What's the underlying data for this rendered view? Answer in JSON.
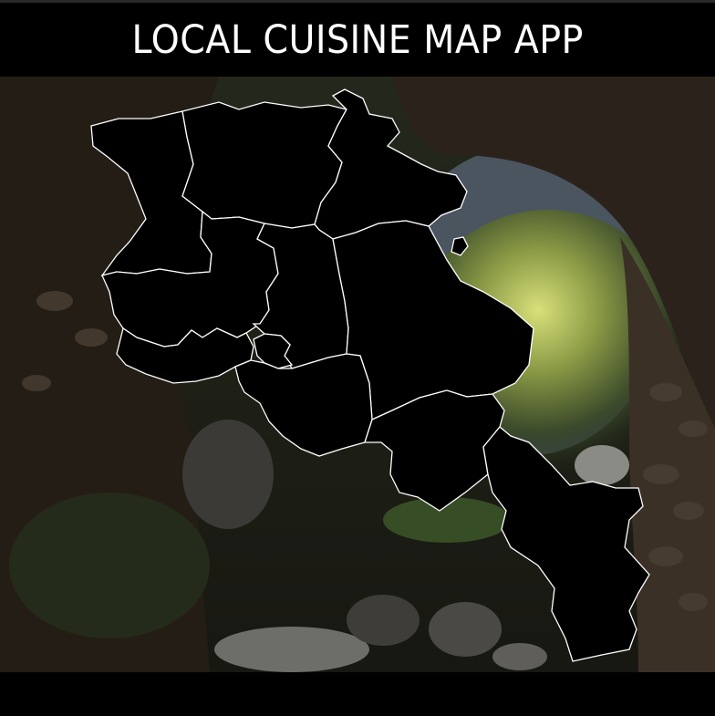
{
  "app": {
    "title": "LOCAL CUISINE MAP APP"
  },
  "map": {
    "background_scene": "stone-bridge-arch-photo",
    "region_fill": "#000000",
    "region_stroke": "#ffffff",
    "regions": [
      {
        "id": "shirak"
      },
      {
        "id": "lori"
      },
      {
        "id": "tavush"
      },
      {
        "id": "aragatsotn"
      },
      {
        "id": "kotayk"
      },
      {
        "id": "gegharkunik"
      },
      {
        "id": "armavir"
      },
      {
        "id": "yerevan"
      },
      {
        "id": "ararat"
      },
      {
        "id": "vayots-dzor"
      },
      {
        "id": "syunik"
      }
    ]
  },
  "colors": {
    "background": "#000000",
    "text": "#ffffff"
  }
}
